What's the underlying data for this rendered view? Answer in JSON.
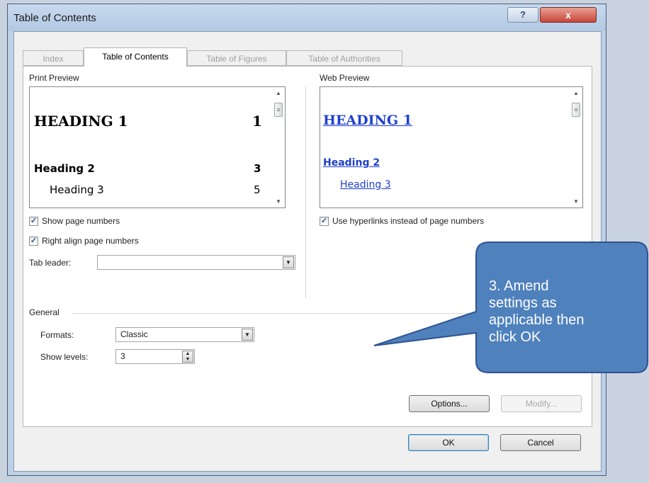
{
  "window": {
    "title": "Table of Contents",
    "help_label": "?",
    "close_label": "x"
  },
  "tabs": [
    {
      "label": "Index",
      "active": false
    },
    {
      "label": "Table of Contents",
      "active": true
    },
    {
      "label": "Table of Figures",
      "active": false
    },
    {
      "label": "Table of Authorities",
      "active": false
    }
  ],
  "print_preview": {
    "label": "Print Preview",
    "heading1": "HEADING 1",
    "heading1_page": "1",
    "heading2": "Heading 2",
    "heading2_page": "3",
    "heading3": "Heading 3",
    "heading3_page": "5"
  },
  "web_preview": {
    "label": "Web Preview",
    "heading1": "HEADING 1",
    "heading2": "Heading 2",
    "heading3": "Heading 3",
    "link_color": "#1f3fcf"
  },
  "options": {
    "show_page_numbers": "Show page numbers",
    "right_align": "Right align page numbers",
    "use_hyperlinks": "Use hyperlinks instead of page numbers",
    "tab_leader_label": "Tab leader:",
    "tab_leader_value": ""
  },
  "general": {
    "label": "General",
    "formats_label": "Formats:",
    "formats_value": "Classic",
    "levels_label": "Show levels:",
    "levels_value": "3"
  },
  "buttons": {
    "options": "Options...",
    "modify": "Modify...",
    "ok": "OK",
    "cancel": "Cancel"
  },
  "callout": {
    "text": "3. Amend settings as applicable then click OK",
    "fill": "#4f81bd",
    "stroke": "#2f528f"
  },
  "icons": {
    "scroll_up": "▲",
    "scroll_down": "▼",
    "grip": "≡",
    "check": "✓",
    "dropdown": "▼"
  }
}
